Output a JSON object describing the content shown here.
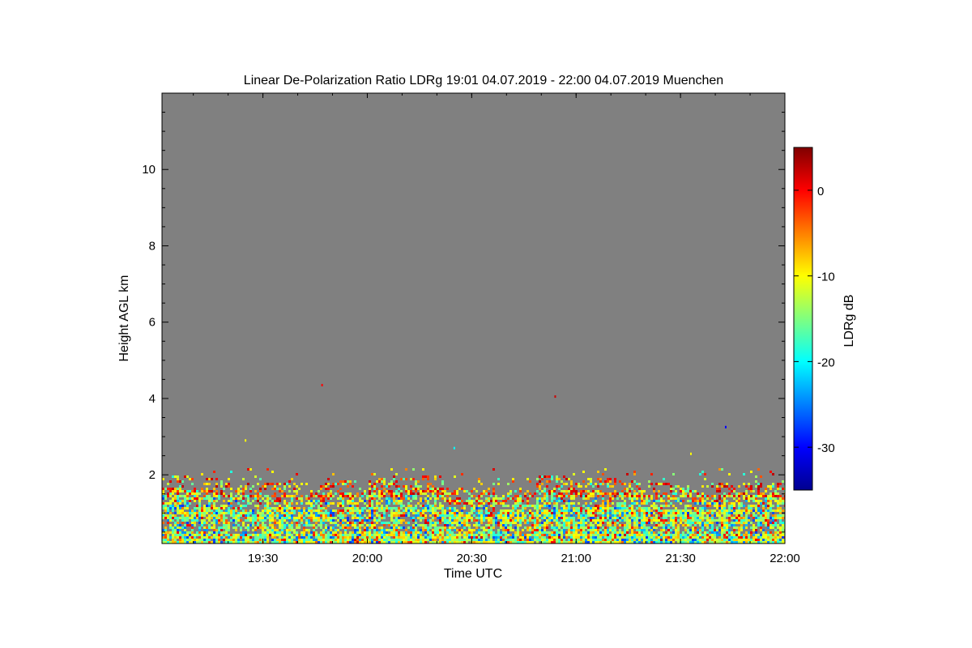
{
  "chart_data": {
    "type": "heatmap",
    "title": "Linear De-Polarization Ratio LDRg   19:01 04.07.2019 - 22:00 04.07.2019 Muenchen",
    "xlabel": "Time UTC",
    "ylabel": "Height AGL km",
    "x_range": [
      "19:01",
      "22:00"
    ],
    "x_tick_labels": [
      "19:30",
      "20:00",
      "20:30",
      "21:00",
      "21:30",
      "22:00"
    ],
    "ylim": [
      0.2,
      12
    ],
    "y_tick_labels": [
      "2",
      "4",
      "6",
      "8",
      "10"
    ],
    "background_color": "#808080",
    "colorbar": {
      "label": "LDRg dB",
      "range": [
        -35,
        5
      ],
      "tick_labels": [
        "0",
        "-10",
        "-20",
        "-30"
      ],
      "colormap": "jet"
    },
    "signal_layer": {
      "top_height_km": 2.0,
      "typical_ldr_db": [
        -20,
        -5
      ]
    },
    "isolated_echoes": [
      {
        "time": "19:47",
        "height_km": 4.35,
        "ldr_db": 0
      },
      {
        "time": "20:54",
        "height_km": 4.05,
        "ldr_db": 2
      },
      {
        "time": "21:43",
        "height_km": 3.25,
        "ldr_db": -30
      },
      {
        "time": "20:25",
        "height_km": 2.7,
        "ldr_db": -20
      },
      {
        "time": "19:25",
        "height_km": 2.9,
        "ldr_db": -10
      },
      {
        "time": "21:33",
        "height_km": 2.55,
        "ldr_db": -10
      }
    ]
  }
}
